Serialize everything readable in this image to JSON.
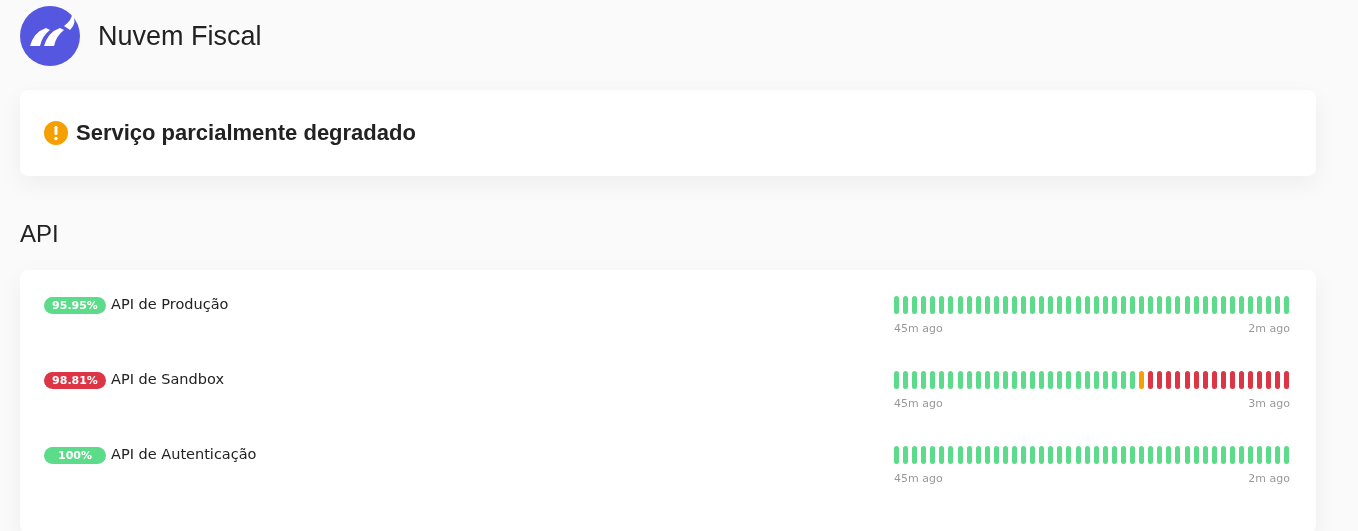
{
  "header": {
    "title": "Nuvem Fiscal"
  },
  "status": {
    "message": "Serviço parcialmente degradado",
    "color": "#f59f00"
  },
  "section": {
    "title": "API"
  },
  "services": [
    {
      "uptime": "95.95%",
      "name": "API de Produção",
      "color": "#5cdb8a",
      "start": "45m ago",
      "end": "2m ago",
      "bars": [
        {
          "color": "#5cdb8a"
        },
        {
          "color": "#5cdb8a"
        },
        {
          "color": "#5cdb8a"
        },
        {
          "color": "#5cdb8a"
        },
        {
          "color": "#5cdb8a"
        },
        {
          "color": "#5cdb8a"
        },
        {
          "color": "#5cdb8a"
        },
        {
          "color": "#5cdb8a"
        },
        {
          "color": "#5cdb8a"
        },
        {
          "color": "#5cdb8a"
        },
        {
          "color": "#5cdb8a"
        },
        {
          "color": "#5cdb8a"
        },
        {
          "color": "#5cdb8a"
        },
        {
          "color": "#5cdb8a"
        },
        {
          "color": "#5cdb8a"
        },
        {
          "color": "#5cdb8a"
        },
        {
          "color": "#5cdb8a"
        },
        {
          "color": "#5cdb8a"
        },
        {
          "color": "#5cdb8a"
        },
        {
          "color": "#5cdb8a"
        },
        {
          "color": "#5cdb8a"
        },
        {
          "color": "#5cdb8a"
        },
        {
          "color": "#5cdb8a"
        },
        {
          "color": "#5cdb8a"
        },
        {
          "color": "#5cdb8a"
        },
        {
          "color": "#5cdb8a"
        },
        {
          "color": "#5cdb8a"
        },
        {
          "color": "#5cdb8a"
        },
        {
          "color": "#5cdb8a"
        },
        {
          "color": "#5cdb8a"
        },
        {
          "color": "#5cdb8a"
        },
        {
          "color": "#5cdb8a"
        },
        {
          "color": "#5cdb8a"
        },
        {
          "color": "#5cdb8a"
        },
        {
          "color": "#5cdb8a"
        },
        {
          "color": "#5cdb8a"
        },
        {
          "color": "#5cdb8a"
        },
        {
          "color": "#5cdb8a"
        },
        {
          "color": "#5cdb8a"
        },
        {
          "color": "#5cdb8a"
        },
        {
          "color": "#5cdb8a"
        },
        {
          "color": "#5cdb8a"
        },
        {
          "color": "#5cdb8a"
        },
        {
          "color": "#5cdb8a"
        }
      ]
    },
    {
      "uptime": "98.81%",
      "name": "API de Sandbox",
      "color": "#dc3545",
      "start": "45m ago",
      "end": "3m ago",
      "bars": [
        {
          "color": "#5cdb8a"
        },
        {
          "color": "#5cdb8a"
        },
        {
          "color": "#5cdb8a"
        },
        {
          "color": "#5cdb8a"
        },
        {
          "color": "#5cdb8a"
        },
        {
          "color": "#5cdb8a"
        },
        {
          "color": "#5cdb8a"
        },
        {
          "color": "#5cdb8a"
        },
        {
          "color": "#5cdb8a"
        },
        {
          "color": "#5cdb8a"
        },
        {
          "color": "#5cdb8a"
        },
        {
          "color": "#5cdb8a"
        },
        {
          "color": "#5cdb8a"
        },
        {
          "color": "#5cdb8a"
        },
        {
          "color": "#5cdb8a"
        },
        {
          "color": "#5cdb8a"
        },
        {
          "color": "#5cdb8a"
        },
        {
          "color": "#5cdb8a"
        },
        {
          "color": "#5cdb8a"
        },
        {
          "color": "#5cdb8a"
        },
        {
          "color": "#5cdb8a"
        },
        {
          "color": "#5cdb8a"
        },
        {
          "color": "#5cdb8a"
        },
        {
          "color": "#5cdb8a"
        },
        {
          "color": "#5cdb8a"
        },
        {
          "color": "#5cdb8a"
        },
        {
          "color": "#5cdb8a"
        },
        {
          "color": "#f59f00"
        },
        {
          "color": "#dc3545"
        },
        {
          "color": "#dc3545"
        },
        {
          "color": "#dc3545"
        },
        {
          "color": "#dc3545"
        },
        {
          "color": "#dc3545"
        },
        {
          "color": "#dc3545"
        },
        {
          "color": "#dc3545"
        },
        {
          "color": "#dc3545"
        },
        {
          "color": "#dc3545"
        },
        {
          "color": "#dc3545"
        },
        {
          "color": "#dc3545"
        },
        {
          "color": "#dc3545"
        },
        {
          "color": "#dc3545"
        },
        {
          "color": "#dc3545"
        },
        {
          "color": "#dc3545"
        },
        {
          "color": "#dc3545"
        }
      ]
    },
    {
      "uptime": "100%",
      "name": "API de Autenticação",
      "color": "#5cdb8a",
      "start": "45m ago",
      "end": "2m ago",
      "bars": [
        {
          "color": "#5cdb8a"
        },
        {
          "color": "#5cdb8a"
        },
        {
          "color": "#5cdb8a"
        },
        {
          "color": "#5cdb8a"
        },
        {
          "color": "#5cdb8a"
        },
        {
          "color": "#5cdb8a"
        },
        {
          "color": "#5cdb8a"
        },
        {
          "color": "#5cdb8a"
        },
        {
          "color": "#5cdb8a"
        },
        {
          "color": "#5cdb8a"
        },
        {
          "color": "#5cdb8a"
        },
        {
          "color": "#5cdb8a"
        },
        {
          "color": "#5cdb8a"
        },
        {
          "color": "#5cdb8a"
        },
        {
          "color": "#5cdb8a"
        },
        {
          "color": "#5cdb8a"
        },
        {
          "color": "#5cdb8a"
        },
        {
          "color": "#5cdb8a"
        },
        {
          "color": "#5cdb8a"
        },
        {
          "color": "#5cdb8a"
        },
        {
          "color": "#5cdb8a"
        },
        {
          "color": "#5cdb8a"
        },
        {
          "color": "#5cdb8a"
        },
        {
          "color": "#5cdb8a"
        },
        {
          "color": "#5cdb8a"
        },
        {
          "color": "#5cdb8a"
        },
        {
          "color": "#5cdb8a"
        },
        {
          "color": "#5cdb8a"
        },
        {
          "color": "#5cdb8a"
        },
        {
          "color": "#5cdb8a"
        },
        {
          "color": "#5cdb8a"
        },
        {
          "color": "#5cdb8a"
        },
        {
          "color": "#5cdb8a"
        },
        {
          "color": "#5cdb8a"
        },
        {
          "color": "#5cdb8a"
        },
        {
          "color": "#5cdb8a"
        },
        {
          "color": "#5cdb8a"
        },
        {
          "color": "#5cdb8a"
        },
        {
          "color": "#5cdb8a"
        },
        {
          "color": "#5cdb8a"
        },
        {
          "color": "#5cdb8a"
        },
        {
          "color": "#5cdb8a"
        },
        {
          "color": "#5cdb8a"
        },
        {
          "color": "#5cdb8a"
        }
      ]
    }
  ]
}
